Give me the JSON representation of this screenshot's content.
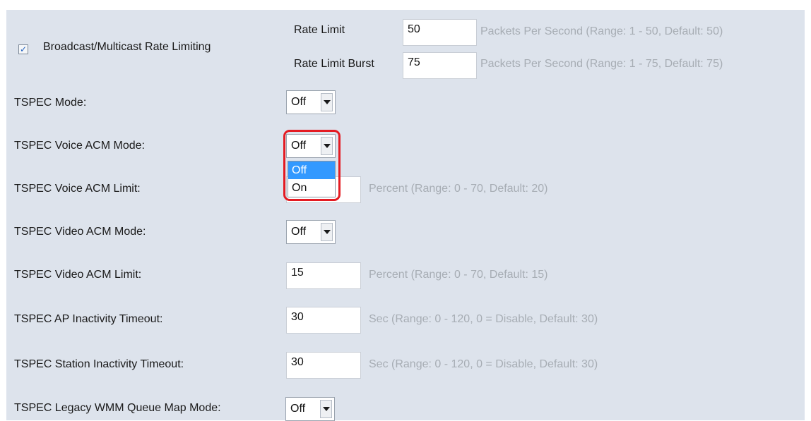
{
  "broadcast": {
    "checkbox_label": "Broadcast/Multicast Rate Limiting",
    "checked_glyph": "✓",
    "rate_limit": {
      "label": "Rate Limit",
      "value": "50",
      "hint": "Packets Per Second (Range: 1 - 50, Default: 50)"
    },
    "rate_limit_burst": {
      "label": "Rate Limit Burst",
      "value": "75",
      "hint": "Packets Per Second (Range: 1 - 75, Default: 75)"
    }
  },
  "tspec_mode": {
    "label": "TSPEC Mode:",
    "value": "Off"
  },
  "voice_acm_mode": {
    "label": "TSPEC Voice ACM Mode:",
    "value": "Off",
    "options": [
      "Off",
      "On"
    ],
    "highlighted_option": "Off"
  },
  "voice_acm_limit": {
    "label": "TSPEC Voice ACM Limit:",
    "value": "",
    "hint": "Percent (Range: 0 - 70, Default: 20)"
  },
  "video_acm_mode": {
    "label": "TSPEC Video ACM Mode:",
    "value": "Off"
  },
  "video_acm_limit": {
    "label": "TSPEC Video ACM Limit:",
    "value": "15",
    "hint": "Percent (Range: 0 - 70, Default: 15)"
  },
  "ap_inactivity_timeout": {
    "label": "TSPEC AP Inactivity Timeout:",
    "value": "30",
    "hint": "Sec (Range: 0 - 120, 0 = Disable, Default: 30)"
  },
  "station_inactivity_timeout": {
    "label": "TSPEC Station Inactivity Timeout:",
    "value": "30",
    "hint": "Sec (Range: 0 - 120, 0 = Disable, Default: 30)"
  },
  "legacy_wmm_queue_map": {
    "label": "TSPEC Legacy WMM Queue Map Mode:",
    "value": "Off"
  },
  "colors": {
    "panel_background": "#dde3ec",
    "hint_text": "#a7adb4",
    "highlight_outline": "#e41b22",
    "selected_option": "#3399ff"
  }
}
